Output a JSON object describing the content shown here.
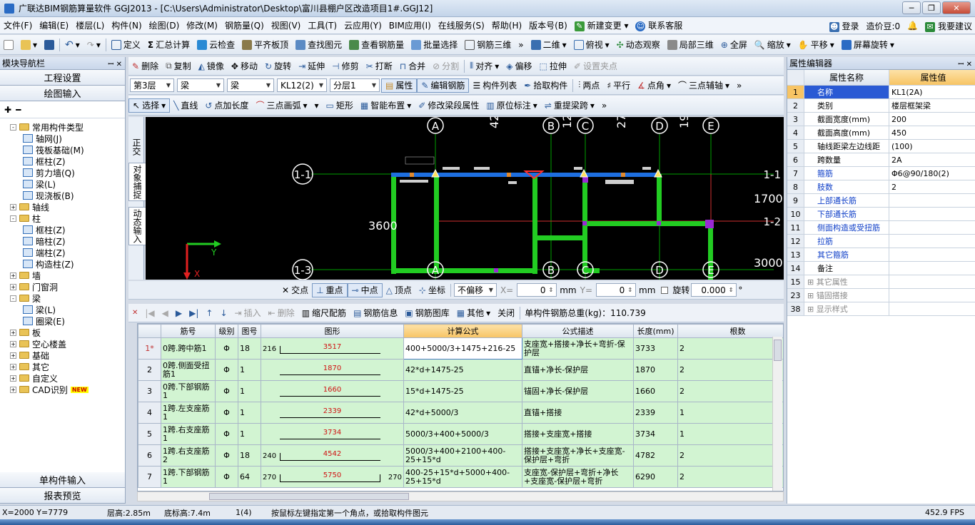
{
  "title": "广联达BIM钢筋算量软件 GGJ2013 - [C:\\Users\\Administrator\\Desktop\\富川县棚户区改造项目1#.GGJ12]",
  "menu": [
    "文件(F)",
    "编辑(E)",
    "楼层(L)",
    "构件(N)",
    "绘图(D)",
    "修改(M)",
    "钢筋量(Q)",
    "视图(V)",
    "工具(T)",
    "云应用(Y)",
    "BIM应用(I)",
    "在线服务(S)",
    "帮助(H)",
    "版本号(B)",
    "新建变更",
    "联系客服"
  ],
  "menu_right": {
    "login": "登录",
    "price": "造价豆:0",
    "suggest": "我要建议"
  },
  "toolbar1": [
    "定义",
    "汇总计算",
    "云检查",
    "平齐板顶",
    "查找图元",
    "查看钢筋量",
    "批量选择",
    "钢筋三维",
    "二维",
    "俯视",
    "动态观察",
    "局部三维",
    "全屏",
    "缩放",
    "平移",
    "屏幕旋转"
  ],
  "toolbar2": [
    "删除",
    "复制",
    "镜像",
    "移动",
    "旋转",
    "延伸",
    "修剪",
    "打断",
    "合并",
    "分割",
    "对齐",
    "偏移",
    "拉伸",
    "设置夹点"
  ],
  "toolbar3": {
    "floor": "第3层",
    "type1": "梁",
    "type2": "梁",
    "member": "KL12(2)",
    "layer": "分层1",
    "btns": [
      "属性",
      "编辑钢筋",
      "构件列表",
      "拾取构件",
      "两点",
      "平行",
      "点角",
      "三点辅轴"
    ]
  },
  "toolbar4": [
    "选择",
    "直线",
    "点加长度",
    "三点画弧",
    "矩形",
    "智能布置",
    "修改梁段属性",
    "原位标注",
    "重提梁跨"
  ],
  "left": {
    "header": "模块导航栏",
    "btn1": "工程设置",
    "btn2": "绘图输入",
    "btn3": "单构件输入",
    "btn4": "报表预览",
    "tree": [
      {
        "level": 0,
        "exp": "-",
        "label": "常用构件类型",
        "folder": true
      },
      {
        "level": 1,
        "label": "轴网(J)"
      },
      {
        "level": 1,
        "label": "筏板基础(M)"
      },
      {
        "level": 1,
        "label": "框柱(Z)"
      },
      {
        "level": 1,
        "label": "剪力墙(Q)"
      },
      {
        "level": 1,
        "label": "梁(L)"
      },
      {
        "level": 1,
        "label": "现浇板(B)"
      },
      {
        "level": 0,
        "exp": "+",
        "label": "轴线",
        "folder": true
      },
      {
        "level": 0,
        "exp": "-",
        "label": "柱",
        "folder": true
      },
      {
        "level": 1,
        "label": "框柱(Z)"
      },
      {
        "level": 1,
        "label": "暗柱(Z)"
      },
      {
        "level": 1,
        "label": "端柱(Z)"
      },
      {
        "level": 1,
        "label": "构造柱(Z)"
      },
      {
        "level": 0,
        "exp": "+",
        "label": "墙",
        "folder": true
      },
      {
        "level": 0,
        "exp": "+",
        "label": "门窗洞",
        "folder": true
      },
      {
        "level": 0,
        "exp": "-",
        "label": "梁",
        "folder": true
      },
      {
        "level": 1,
        "label": "梁(L)"
      },
      {
        "level": 1,
        "label": "圈梁(E)"
      },
      {
        "level": 0,
        "exp": "+",
        "label": "板",
        "folder": true
      },
      {
        "level": 0,
        "exp": "+",
        "label": "空心楼盖",
        "folder": true
      },
      {
        "level": 0,
        "exp": "+",
        "label": "基础",
        "folder": true
      },
      {
        "level": 0,
        "exp": "+",
        "label": "其它",
        "folder": true
      },
      {
        "level": 0,
        "exp": "+",
        "label": "自定义",
        "folder": true
      },
      {
        "level": 0,
        "exp": "+",
        "label": "CAD识别",
        "folder": true,
        "badge": "NEW"
      }
    ]
  },
  "vtabs": [
    "正交",
    "对象捕捉",
    "动态输入"
  ],
  "canvas": {
    "axes_top": [
      "A",
      "B",
      "C",
      "D",
      "E"
    ],
    "axes_left": [
      "1-1",
      "1-3"
    ],
    "axes_right": [
      "1-1",
      "1-2"
    ],
    "dims_top": [
      "42",
      "12",
      "27",
      "19"
    ],
    "dims": {
      "left": "3600",
      "right1": "1700",
      "right2": "3000"
    },
    "axis_y": "Y",
    "axis_x": "X"
  },
  "snapbar": {
    "items": [
      "交点",
      "重点",
      "中点",
      "顶点",
      "坐标"
    ],
    "offset": "不偏移",
    "x_label": "X=",
    "x": "0",
    "y_label": "Y=",
    "y": "0",
    "unit": "mm",
    "rotate": "旋转",
    "angle": "0.000",
    "deg": "°"
  },
  "rebar_toolbar": {
    "items": [
      "插入",
      "删除",
      "缩尺配筋",
      "钢筋信息",
      "钢筋图库",
      "其他",
      "关闭"
    ],
    "total": "单构件钢筋总重(kg)：110.739"
  },
  "table": {
    "headers": [
      "",
      "筋号",
      "级别",
      "图号",
      "图形",
      "计算公式",
      "公式描述",
      "长度(mm)",
      "根数"
    ],
    "rows": [
      {
        "n": "1*",
        "name": "0跨.跨中筋1",
        "grade": "Φ",
        "fig": "18",
        "left": "216",
        "mid": "3517",
        "right": "",
        "formula": "400+5000/3+1475+216-25",
        "desc": "支座宽+搭接+净长+弯折-保护层",
        "len": "3733",
        "cnt": "2"
      },
      {
        "n": "2",
        "name": "0跨.侧面受扭筋1",
        "grade": "Φ",
        "fig": "1",
        "left": "",
        "mid": "1870",
        "right": "",
        "formula": "42*d+1475-25",
        "desc": "直锚+净长-保护层",
        "len": "1870",
        "cnt": "2"
      },
      {
        "n": "3",
        "name": "0跨.下部钢筋1",
        "grade": "Φ",
        "fig": "1",
        "left": "",
        "mid": "1660",
        "right": "",
        "formula": "15*d+1475-25",
        "desc": "锚固+净长-保护层",
        "len": "1660",
        "cnt": "2"
      },
      {
        "n": "4",
        "name": "1跨.左支座筋1",
        "grade": "Φ",
        "fig": "1",
        "left": "",
        "mid": "2339",
        "right": "",
        "formula": "42*d+5000/3",
        "desc": "直锚+搭接",
        "len": "2339",
        "cnt": "1"
      },
      {
        "n": "5",
        "name": "1跨.右支座筋1",
        "grade": "Φ",
        "fig": "1",
        "left": "",
        "mid": "3734",
        "right": "",
        "formula": "5000/3+400+5000/3",
        "desc": "搭接+支座宽+搭接",
        "len": "3734",
        "cnt": "1"
      },
      {
        "n": "6",
        "name": "1跨.右支座筋2",
        "grade": "Φ",
        "fig": "18",
        "left": "240",
        "mid": "4542",
        "right": "",
        "formula": "5000/3+400+2100+400-25+15*d",
        "desc": "搭接+支座宽+净长+支座宽-保护层+弯折",
        "len": "4782",
        "cnt": "2"
      },
      {
        "n": "7",
        "name": "1跨.下部钢筋1",
        "grade": "Φ",
        "fig": "64",
        "left": "270",
        "mid": "5750",
        "right": "270",
        "formula": "400-25+15*d+5000+400-25+15*d",
        "desc": "支座宽-保护层+弯折+净长+支座宽-保护层+弯折",
        "len": "6290",
        "cnt": "2"
      }
    ]
  },
  "right": {
    "header": "属性编辑器",
    "col_name": "属性名称",
    "col_val": "属性值",
    "rows": [
      {
        "n": "1",
        "name": "名称",
        "val": "KL1(2A)",
        "blue": true
      },
      {
        "n": "2",
        "name": "类别",
        "val": "楼层框架梁",
        "blue": false
      },
      {
        "n": "3",
        "name": "截面宽度(mm)",
        "val": "200",
        "blue": false
      },
      {
        "n": "4",
        "name": "截面高度(mm)",
        "val": "450",
        "blue": false
      },
      {
        "n": "5",
        "name": "轴线距梁左边线距",
        "val": "(100)",
        "blue": false
      },
      {
        "n": "6",
        "name": "跨数量",
        "val": "2A",
        "blue": false
      },
      {
        "n": "7",
        "name": "箍筋",
        "val": "Φ6@90/180(2)",
        "blue": true
      },
      {
        "n": "8",
        "name": "肢数",
        "val": "2",
        "blue": true
      },
      {
        "n": "9",
        "name": "上部通长筋",
        "val": "",
        "blue": true
      },
      {
        "n": "10",
        "name": "下部通长筋",
        "val": "",
        "blue": true
      },
      {
        "n": "11",
        "name": "侧面构造或受扭筋",
        "val": "",
        "blue": true
      },
      {
        "n": "12",
        "name": "拉筋",
        "val": "",
        "blue": true
      },
      {
        "n": "13",
        "name": "其它箍筋",
        "val": "",
        "blue": true
      },
      {
        "n": "14",
        "name": "备注",
        "val": "",
        "blue": false
      },
      {
        "n": "15",
        "name": "其它属性",
        "val": "",
        "group": true
      },
      {
        "n": "23",
        "name": "锚固搭接",
        "val": "",
        "group": true
      },
      {
        "n": "38",
        "name": "显示样式",
        "val": "",
        "group": true
      }
    ]
  },
  "status": {
    "coords": "X=2000 Y=7779",
    "floor_h": "层高:2.85m",
    "base_h": "底标高:7.4m",
    "count": "1(4)",
    "hint": "按鼠标左键指定第一个角点，或拾取构件图元",
    "fps": "452.9 FPS"
  },
  "colors": {
    "accent": "#2a6bc4",
    "grid": "#00c000",
    "beam": "#1e6fe0",
    "rowbg": "#d2f4d2"
  }
}
